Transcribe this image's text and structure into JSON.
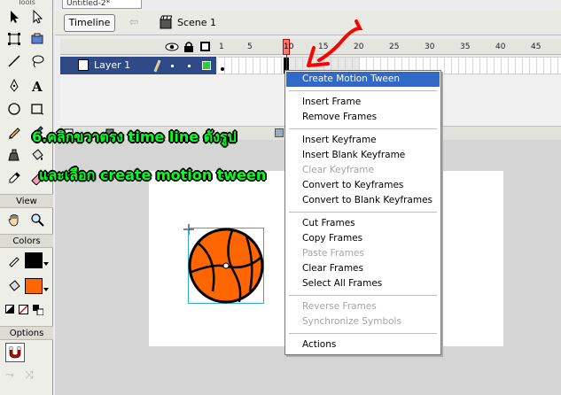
{
  "document_tab": "Untitled-2*",
  "tools_panel": {
    "title": "Tools",
    "view_label": "View",
    "colors_label": "Colors",
    "options_label": "Options",
    "stroke_color": "#000000",
    "fill_color": "#ff6600"
  },
  "edit_bar": {
    "timeline_button": "Timeline",
    "scene_label": "Scene 1"
  },
  "timeline": {
    "ruler_numbers": [
      "1",
      "5",
      "10",
      "15",
      "20",
      "25",
      "30",
      "35",
      "40",
      "45"
    ],
    "layer_name": "Layer 1",
    "current_frame": 10
  },
  "context_menu": {
    "items": [
      {
        "label": "Create Motion Tween",
        "state": "highlighted"
      },
      {
        "label": "Insert Frame",
        "state": "enabled"
      },
      {
        "label": "Remove Frames",
        "state": "enabled"
      },
      {
        "label": "Insert Keyframe",
        "state": "enabled"
      },
      {
        "label": "Insert Blank Keyframe",
        "state": "enabled"
      },
      {
        "label": "Clear Keyframe",
        "state": "disabled"
      },
      {
        "label": "Convert to Keyframes",
        "state": "enabled"
      },
      {
        "label": "Convert to Blank Keyframes",
        "state": "enabled"
      },
      {
        "label": "Cut Frames",
        "state": "enabled"
      },
      {
        "label": "Copy Frames",
        "state": "enabled"
      },
      {
        "label": "Paste Frames",
        "state": "disabled"
      },
      {
        "label": "Clear Frames",
        "state": "enabled"
      },
      {
        "label": "Select All Frames",
        "state": "enabled"
      },
      {
        "label": "Reverse Frames",
        "state": "disabled"
      },
      {
        "label": "Synchronize Symbols",
        "state": "disabled"
      },
      {
        "label": "Actions",
        "state": "enabled"
      }
    ]
  },
  "annotation": {
    "line1": "6.คลิกขวาตรง time line ดังรูป",
    "line2": "และเลือก create motion tween",
    "text_color": "#00ff22",
    "arrow_color": "#ff0000"
  },
  "stage": {
    "ball_color": "#ff6600"
  }
}
